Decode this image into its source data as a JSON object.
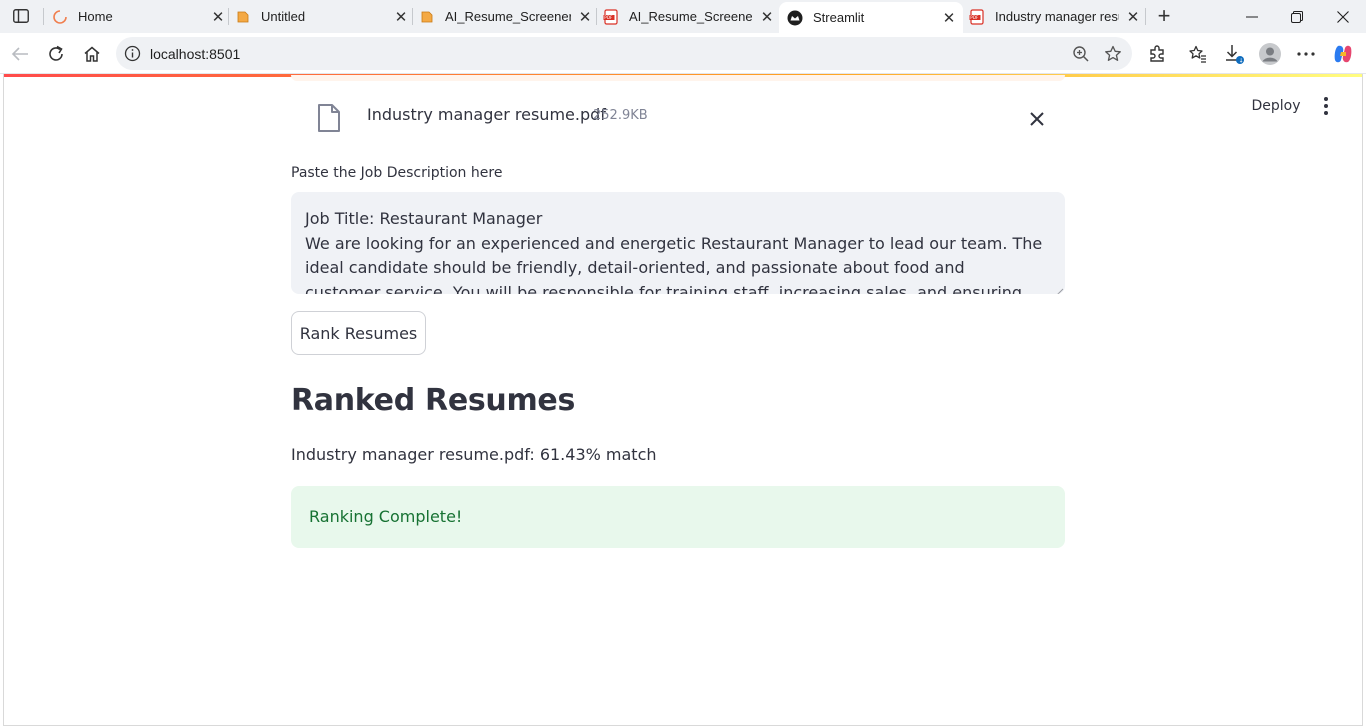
{
  "browser": {
    "tabs": [
      {
        "title": "Home",
        "icon": "spinner-icon"
      },
      {
        "title": "Untitled",
        "icon": "book-icon"
      },
      {
        "title": "AI_Resume_Screener",
        "icon": "book-icon"
      },
      {
        "title": "AI_Resume_Screener.pd",
        "icon": "pdf-icon"
      },
      {
        "title": "Streamlit",
        "icon": "streamlit-icon",
        "active": true
      },
      {
        "title": "Industry manager resu",
        "icon": "pdf-icon"
      }
    ],
    "url": "localhost:8501"
  },
  "app": {
    "header": {
      "deploy_label": "Deploy"
    },
    "uploaded_file": {
      "name": "Industry manager resume.pdf",
      "size": "252.9KB"
    },
    "job_description": {
      "label": "Paste the Job Description here",
      "value": "Job Title: Restaurant Manager\nWe are looking for an experienced and energetic Restaurant Manager to lead our team. The ideal candidate should be friendly, detail-oriented, and passionate about food and customer service. You will be responsible for training staff, increasing sales, and ensuring customer satisfaction."
    },
    "rank_button_label": "Rank Resumes",
    "results": {
      "heading": "Ranked Resumes",
      "items": [
        "Industry manager resume.pdf: 61.43% match"
      ]
    },
    "status": {
      "message": "Ranking Complete!"
    }
  },
  "colors": {
    "accent": "#ff4b4b",
    "success_bg": "#e8f8ec",
    "success_text": "#177233",
    "input_bg": "#f0f2f6"
  }
}
